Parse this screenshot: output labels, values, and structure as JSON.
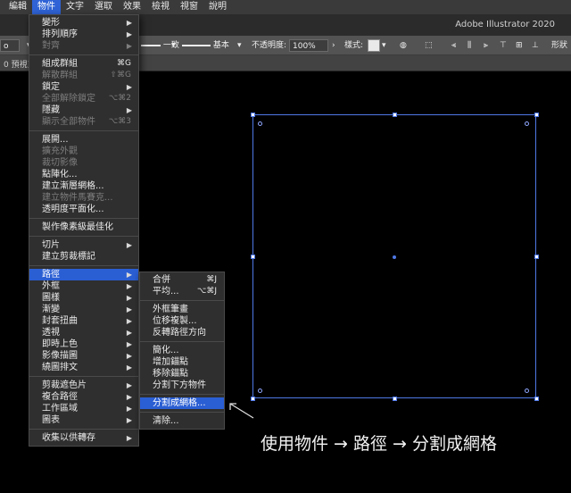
{
  "menubar": {
    "items": [
      {
        "label": "編輯",
        "active": false
      },
      {
        "label": "物件",
        "active": true
      },
      {
        "label": "文字",
        "active": false
      },
      {
        "label": "選取",
        "active": false
      },
      {
        "label": "效果",
        "active": false
      },
      {
        "label": "檢視",
        "active": false
      },
      {
        "label": "視窗",
        "active": false
      },
      {
        "label": "說明",
        "active": false
      }
    ]
  },
  "titlebar": {
    "app_title": "Adobe Illustrator 2020"
  },
  "controlbar": {
    "stroke_profile_label": "一致",
    "brush_label": "基本",
    "opacity_label": "不透明度:",
    "opacity_value": "100%",
    "style_label": "樣式:",
    "right_cut_label": "形狀",
    "left_cut_value": "o"
  },
  "tabstrip": {
    "doc_tab": "0 預視)"
  },
  "object_menu": {
    "items": [
      {
        "label": "變形",
        "submenu": true,
        "disabled": false
      },
      {
        "label": "排列順序",
        "submenu": true,
        "disabled": false
      },
      {
        "label": "對齊",
        "submenu": true,
        "disabled": true
      },
      {
        "sep": true
      },
      {
        "label": "組成群組",
        "shortcut": "⌘G",
        "disabled": false
      },
      {
        "label": "解散群組",
        "shortcut": "⇧⌘G",
        "disabled": true
      },
      {
        "label": "鎖定",
        "submenu": true,
        "disabled": false
      },
      {
        "label": "全部解除鎖定",
        "shortcut": "⌥⌘2",
        "disabled": true
      },
      {
        "label": "隱藏",
        "submenu": true,
        "disabled": false
      },
      {
        "label": "顯示全部物件",
        "shortcut": "⌥⌘3",
        "disabled": true
      },
      {
        "sep": true
      },
      {
        "label": "展開...",
        "disabled": false
      },
      {
        "label": "擴充外觀",
        "disabled": true
      },
      {
        "label": "裁切影像",
        "disabled": true
      },
      {
        "label": "點陣化...",
        "disabled": false
      },
      {
        "label": "建立漸層網格...",
        "disabled": false
      },
      {
        "label": "建立物件馬賽克...",
        "disabled": true
      },
      {
        "label": "透明度平面化...",
        "disabled": false
      },
      {
        "sep": true
      },
      {
        "label": "製作像素級最佳化",
        "disabled": false
      },
      {
        "sep": true
      },
      {
        "label": "切片",
        "submenu": true,
        "disabled": false
      },
      {
        "label": "建立剪裁標記",
        "disabled": false
      },
      {
        "sep": true
      },
      {
        "label": "路徑",
        "submenu": true,
        "disabled": false,
        "highlight": true
      },
      {
        "label": "外框",
        "submenu": true,
        "disabled": false
      },
      {
        "label": "圖樣",
        "submenu": true,
        "disabled": false
      },
      {
        "label": "漸變",
        "submenu": true,
        "disabled": false
      },
      {
        "label": "封套扭曲",
        "submenu": true,
        "disabled": false
      },
      {
        "label": "透視",
        "submenu": true,
        "disabled": false
      },
      {
        "label": "即時上色",
        "submenu": true,
        "disabled": false
      },
      {
        "label": "影像描圖",
        "submenu": true,
        "disabled": false
      },
      {
        "label": "繞圖排文",
        "submenu": true,
        "disabled": false
      },
      {
        "sep": true
      },
      {
        "label": "剪裁遮色片",
        "submenu": true,
        "disabled": false
      },
      {
        "label": "複合路徑",
        "submenu": true,
        "disabled": false
      },
      {
        "label": "工作區域",
        "submenu": true,
        "disabled": false
      },
      {
        "label": "圖表",
        "submenu": true,
        "disabled": false
      },
      {
        "sep": true
      },
      {
        "label": "收集以供轉存",
        "submenu": true,
        "disabled": false
      }
    ]
  },
  "path_submenu": {
    "items": [
      {
        "label": "合併",
        "shortcut": "⌘J"
      },
      {
        "label": "平均...",
        "shortcut": "⌥⌘J"
      },
      {
        "sep": true
      },
      {
        "label": "外框筆畫"
      },
      {
        "label": "位移複製..."
      },
      {
        "label": "反轉路徑方向"
      },
      {
        "sep": true
      },
      {
        "label": "簡化..."
      },
      {
        "label": "增加錨點"
      },
      {
        "label": "移除錨點"
      },
      {
        "label": "分割下方物件"
      },
      {
        "sep": true
      },
      {
        "label": "分割成網格...",
        "highlight": true
      },
      {
        "sep": true
      },
      {
        "label": "清除..."
      }
    ]
  },
  "annotation": {
    "text": "使用物件 → 路徑 → 分割成網格"
  },
  "colors": {
    "selection": "#4f78e6",
    "menu_highlight": "#2a5ed3",
    "menu_bg": "#2f2f2f"
  }
}
